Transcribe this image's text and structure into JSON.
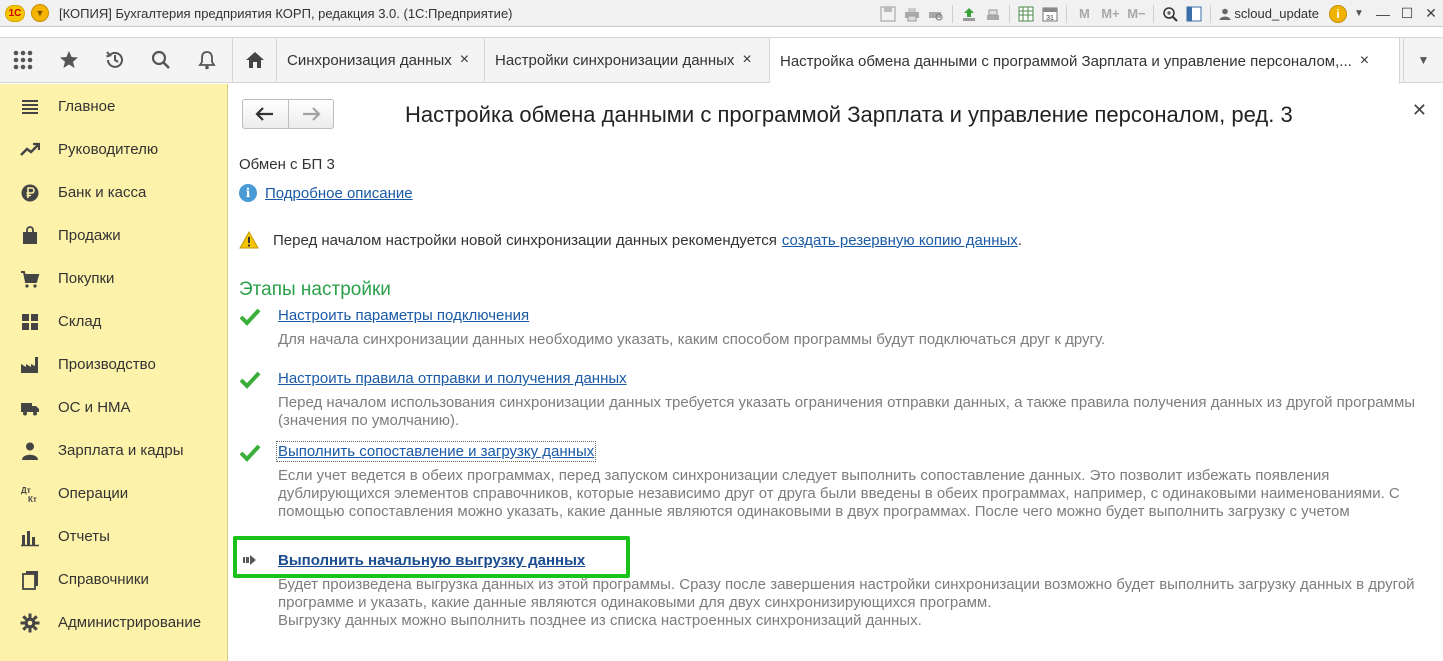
{
  "window": {
    "logo": "1С",
    "title": "[КОПИЯ] Бухгалтерия предприятия КОРП, редакция 3.0. (1С:Предприятие)",
    "user": "scloud_update",
    "memory_buttons": [
      "M",
      "M+",
      "M−"
    ]
  },
  "tabs": {
    "items": [
      {
        "label": "Синхронизация данных"
      },
      {
        "label": "Настройки синхронизации данных"
      },
      {
        "label": "Настройка обмена данными с программой Зарплата и управление персоналом,...",
        "active": true
      }
    ],
    "close_glyph": "×"
  },
  "sidebar": {
    "items": [
      {
        "label": "Главное",
        "icon": "menu-lines-icon"
      },
      {
        "label": "Руководителю",
        "icon": "trend-icon"
      },
      {
        "label": "Банк и касса",
        "icon": "ruble-coin-icon"
      },
      {
        "label": "Продажи",
        "icon": "shopping-bag-icon"
      },
      {
        "label": "Покупки",
        "icon": "cart-icon"
      },
      {
        "label": "Склад",
        "icon": "warehouse-grid-icon"
      },
      {
        "label": "Производство",
        "icon": "factory-icon"
      },
      {
        "label": "ОС и НМА",
        "icon": "truck-icon"
      },
      {
        "label": "Зарплата и кадры",
        "icon": "person-icon"
      },
      {
        "label": "Операции",
        "icon": "dt-kt-icon"
      },
      {
        "label": "Отчеты",
        "icon": "bar-chart-icon"
      },
      {
        "label": "Справочники",
        "icon": "books-icon"
      },
      {
        "label": "Администрирование",
        "icon": "gear-icon"
      }
    ]
  },
  "form": {
    "title": "Настройка обмена данными с программой Зарплата и управление персоналом, ред. 3",
    "exchange_name": "Обмен с БП 3",
    "description_link": "Подробное описание",
    "warning_text": "Перед началом настройки новой синхронизации данных рекомендуется",
    "warning_link": "создать резервную копию данных",
    "warning_end": ".",
    "stages_heading": "Этапы настройки",
    "steps": [
      {
        "link": "Настроить параметры подключения",
        "text": "Для начала синхронизации данных необходимо указать, каким способом программы будут подключаться друг к другу.",
        "status": "done"
      },
      {
        "link": "Настроить правила отправки и получения данных",
        "text": "Перед началом использования синхронизации данных требуется указать ограничения отправки данных, а также правила получения данных из другой программы (значения по умолчанию).",
        "status": "done"
      },
      {
        "link": "Выполнить сопоставление и загрузку данных",
        "text": "Если учет ведется в обеих программах, перед запуском синхронизации следует выполнить сопоставление данных. Это позволит избежать появления дублирующихся элементов справочников, которые независимо друг от друга были введены в обеих программах, например, с одинаковыми наименованиями. С помощью сопоставления можно указать, какие данные являются одинаковыми в двух программах. После чего можно будет выполнить загрузку с учетом настроенных сопоставлений.",
        "status": "done"
      },
      {
        "link": "Выполнить начальную выгрузку данных",
        "text": "Будет произведена выгрузка данных из этой программы. Сразу после завершения настройки синхронизации возможно будет выполнить загрузку данных в другой программе и указать, какие данные являются одинаковыми для двух синхронизирующихся программ.\nВыгрузку данных можно выполнить позднее из списка настроенных синхронизаций данных.",
        "status": "current"
      }
    ]
  },
  "colors": {
    "sidebar_bg": "#fdf2a9",
    "link": "#1a5aa6",
    "heading_green": "#2ba04a",
    "check_green": "#3aae3a",
    "highlight_box": "#19c319"
  }
}
